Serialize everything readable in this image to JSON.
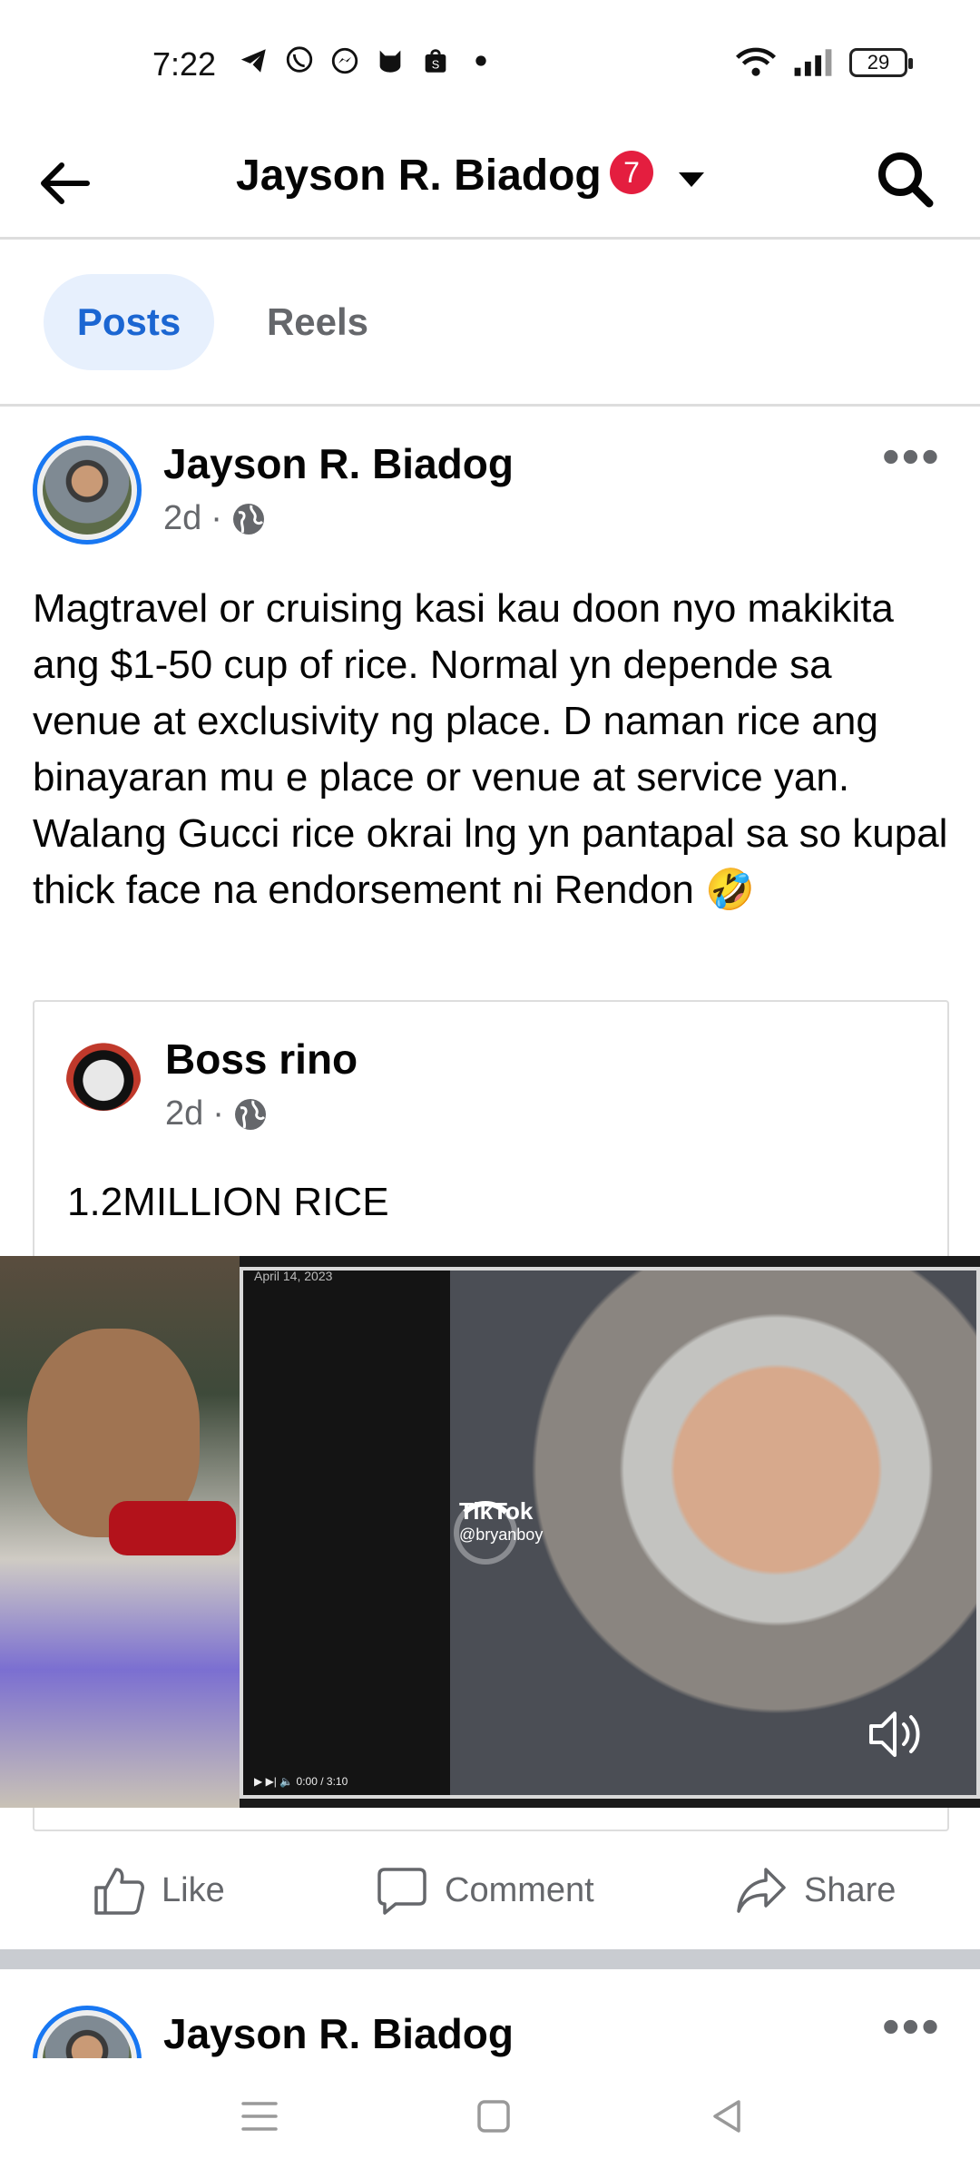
{
  "status_bar": {
    "time": "7:22",
    "notification_icons": [
      "telegram-icon",
      "viber-icon",
      "messenger-icon",
      "cat-icon",
      "shopee-icon",
      "dot-icon"
    ],
    "battery": "29"
  },
  "header": {
    "title": "Jayson R. Biadog",
    "badge_count": "7"
  },
  "tabs": [
    {
      "label": "Posts",
      "active": true
    },
    {
      "label": "Reels",
      "active": false
    }
  ],
  "post": {
    "author": "Jayson R. Biadog",
    "time": "2d",
    "separator": "·",
    "text": "Magtravel or cruising kasi kau doon nyo makikita ang $1-50 cup of rice. Normal yn depende sa venue at exclusivity ng place. D naman rice ang binayaran mu e place or venue at service yan. Walang Gucci rice okrai lng yn pantapal sa so kupal thick face na endorsement ni Rendon 🤣",
    "shared": {
      "author": "Boss rino",
      "time": "2d",
      "text": "1.2MILLION RICE",
      "video": {
        "watermark_title": "TikTok",
        "watermark_handle": "@bryanboy",
        "date_stamp": "April 14, 2023",
        "player_time": "0:00 / 3:10"
      }
    },
    "actions": {
      "like": "Like",
      "comment": "Comment",
      "share": "Share"
    }
  },
  "next_post": {
    "author": "Jayson R. Biadog"
  },
  "colors": {
    "accent": "#1877f2",
    "tab_active_bg": "#e7f0fd",
    "tab_active_text": "#1b66d2",
    "badge": "#e41e3f",
    "muted": "#65676b"
  }
}
